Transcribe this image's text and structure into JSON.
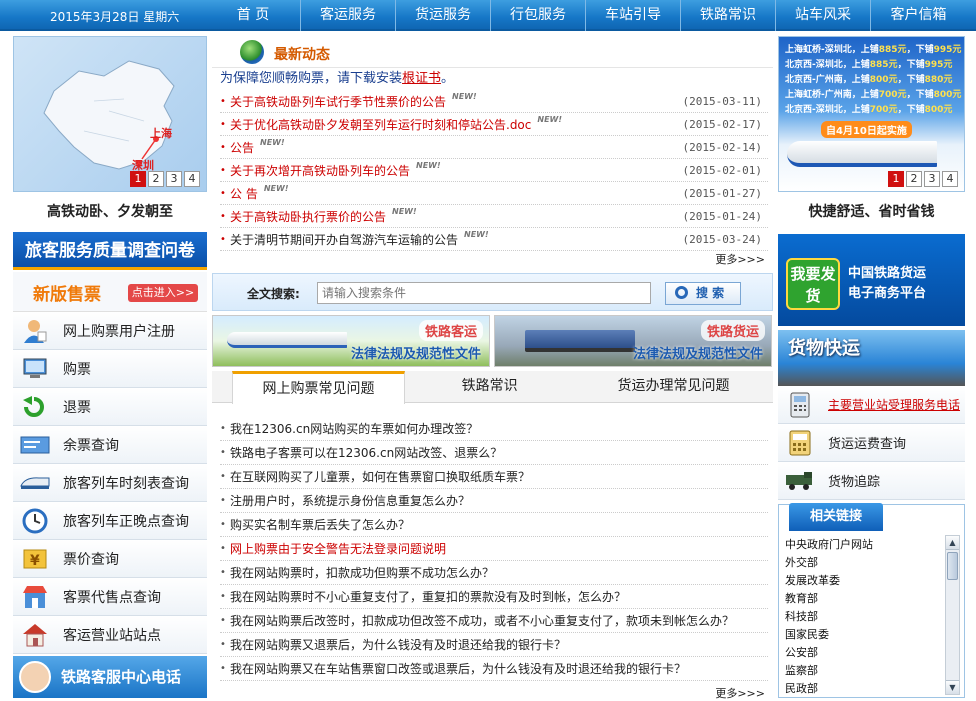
{
  "topnav": {
    "date": "2015年3月28日 星期六",
    "items": [
      "首 页",
      "客运服务",
      "货运服务",
      "行包服务",
      "车站引导",
      "铁路常识",
      "站车风采",
      "客户信箱"
    ]
  },
  "left": {
    "map_slider": {
      "pages": [
        "1",
        "2",
        "3",
        "4"
      ],
      "active": "1",
      "labels": [
        "上海",
        "深圳"
      ]
    },
    "caption": "高铁动卧、夕发朝至",
    "survey_banner": "旅客服务质量调查问卷",
    "new_ticket": {
      "title": "新版售票",
      "button": "点击进入>>"
    },
    "menu": [
      {
        "label": "网上购票用户注册",
        "icon": "user-register-icon"
      },
      {
        "label": "购票",
        "icon": "computer-icon"
      },
      {
        "label": "退票",
        "icon": "return-arrow-icon"
      },
      {
        "label": "余票查询",
        "icon": "ticket-query-icon"
      },
      {
        "label": "旅客列车时刻表查询",
        "icon": "train-schedule-icon"
      },
      {
        "label": "旅客列车正晚点查询",
        "icon": "clock-icon"
      },
      {
        "label": "票价查询",
        "icon": "yen-price-icon"
      },
      {
        "label": "客票代售点查询",
        "icon": "shop-icon"
      },
      {
        "label": "客运营业站站点",
        "icon": "station-house-icon"
      }
    ],
    "service_banner": "铁路客服中心电话"
  },
  "center": {
    "news": {
      "title": "最新动态",
      "notice_prefix": "为保障您顺畅购票，请下载安装",
      "notice_link": "根证书",
      "notice_suffix": "。",
      "new_tag": "NEW!",
      "items": [
        {
          "text": "关于高铁动卧列车试行季节性票价的公告",
          "date": "(2015-03-11)",
          "red": true
        },
        {
          "text": "关于优化高铁动卧夕发朝至列车运行时刻和停站公告.doc",
          "date": "(2015-02-17)",
          "red": true
        },
        {
          "text": "公告",
          "date": "(2015-02-14)",
          "red": true
        },
        {
          "text": "关于再次增开高铁动卧列车的公告",
          "date": "(2015-02-01)",
          "red": true
        },
        {
          "text": "公 告",
          "date": "(2015-01-27)",
          "red": true
        },
        {
          "text": "关于高铁动卧执行票价的公告",
          "date": "(2015-01-24)",
          "red": true
        },
        {
          "text": "关于清明节期间开办自驾游汽车运输的公告",
          "date": "(2015-03-24)",
          "red": false
        }
      ],
      "more": "更多>>>"
    },
    "search": {
      "label": "全文搜索:",
      "placeholder": "请输入搜索条件",
      "button": "搜 索"
    },
    "law_banners": [
      {
        "tag": "铁路客运",
        "text": "法律法规及规范性文件"
      },
      {
        "tag": "铁路货运",
        "text": "法律法规及规范性文件"
      }
    ],
    "faq": {
      "tabs": [
        "网上购票常见问题",
        "铁路常识",
        "货运办理常见问题"
      ],
      "items": [
        {
          "text": "我在12306.cn网站购买的车票如何办理改签？",
          "red": false
        },
        {
          "text": "铁路电子客票可以在12306.cn网站改签、退票么？",
          "red": false
        },
        {
          "text": "在互联网购买了儿童票，如何在售票窗口换取纸质车票？",
          "red": false
        },
        {
          "text": "注册用户时，系统提示身份信息重复怎么办？",
          "red": false
        },
        {
          "text": "购买实名制车票后丢失了怎么办？",
          "red": false
        },
        {
          "text": "网上购票由于安全警告无法登录问题说明",
          "red": true
        },
        {
          "text": "我在网站购票时，扣款成功但购票不成功怎么办？",
          "red": false
        },
        {
          "text": "我在网站购票时不小心重复支付了，重复扣的票款没有及时到帐，怎么办？",
          "red": false
        },
        {
          "text": "我在网站购票后改签时，扣款成功但改签不成功，或者不小心重复支付了，款项未到帐怎么办？",
          "red": false
        },
        {
          "text": "我在网站购票又退票后，为什么钱没有及时退还给我的银行卡？",
          "red": false
        },
        {
          "text": "我在网站购票又在车站售票窗口改签或退票后，为什么钱没有及时退还给我的银行卡？",
          "red": false
        }
      ],
      "more": "更多>>>"
    }
  },
  "right": {
    "promo": {
      "rows": [
        {
          "route": "上海虹桥-深圳北，",
          "lower": "上铺",
          "p1": "885元",
          "sep": "，下铺",
          "p2": "995元"
        },
        {
          "route": "北京西-深圳北，",
          "lower": "上铺",
          "p1": "885元",
          "sep": "，下铺",
          "p2": "995元"
        },
        {
          "route": "北京西-广州南，",
          "lower": "上铺",
          "p1": "800元",
          "sep": "，下铺",
          "p2": "880元"
        },
        {
          "route": "上海虹桥-广州南，",
          "lower": "上铺",
          "p1": "700元",
          "sep": "，下铺",
          "p2": "800元"
        },
        {
          "route": "北京西-深圳北，",
          "lower": "上铺",
          "p1": "700元",
          "sep": "，下铺",
          "p2": "800元"
        }
      ],
      "start": "自4月10日起实施",
      "pages": [
        "1",
        "2",
        "3",
        "4"
      ],
      "active": "1"
    },
    "caption": "快捷舒适、省时省钱",
    "freight_banner": {
      "box": "我要发货",
      "line1": "中国铁路货运",
      "line2": "电子商务平台"
    },
    "express": "货物快运",
    "menu": [
      {
        "label": "主要营业站受理服务电话",
        "icon": "phone-icon",
        "red": true
      },
      {
        "label": "货运运费查询",
        "icon": "calculator-icon",
        "red": false
      },
      {
        "label": "货物追踪",
        "icon": "locomotive-icon",
        "red": false
      }
    ],
    "links": {
      "title": "相关链接",
      "items": [
        "中央政府门户网站",
        "外交部",
        "发展改革委",
        "教育部",
        "科技部",
        "国家民委",
        "公安部",
        "监察部",
        "民政部"
      ]
    }
  }
}
